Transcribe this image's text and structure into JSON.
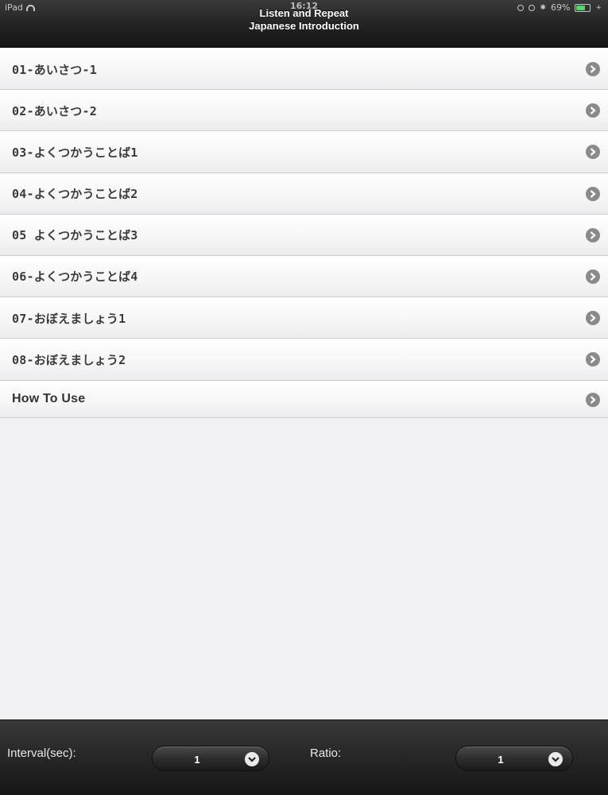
{
  "status_bar": {
    "device": "iPad",
    "time": "16:12",
    "battery": "69%",
    "battery_level": 0.69
  },
  "header": {
    "title": "Listen and Repeat",
    "subtitle": "Japanese Introduction"
  },
  "list": {
    "items": [
      {
        "label": "01-あいさつ-1"
      },
      {
        "label": "02-あいさつ-2"
      },
      {
        "label": "03-よくつかうことば1"
      },
      {
        "label": "04-よくつかうことば2"
      },
      {
        "label": "05 よくつかうことば3"
      },
      {
        "label": "06-よくつかうことば4"
      },
      {
        "label": "07-おぼえましょう1"
      },
      {
        "label": "08-おぼえましょう2"
      },
      {
        "label": "How To Use"
      }
    ]
  },
  "footer": {
    "interval_label": "Interval(sec):",
    "interval_value": "1",
    "ratio_label": "Ratio:",
    "ratio_value": "1"
  },
  "colors": {
    "accent_battery": "#4cd964",
    "chevron": "#8a8a8a"
  }
}
